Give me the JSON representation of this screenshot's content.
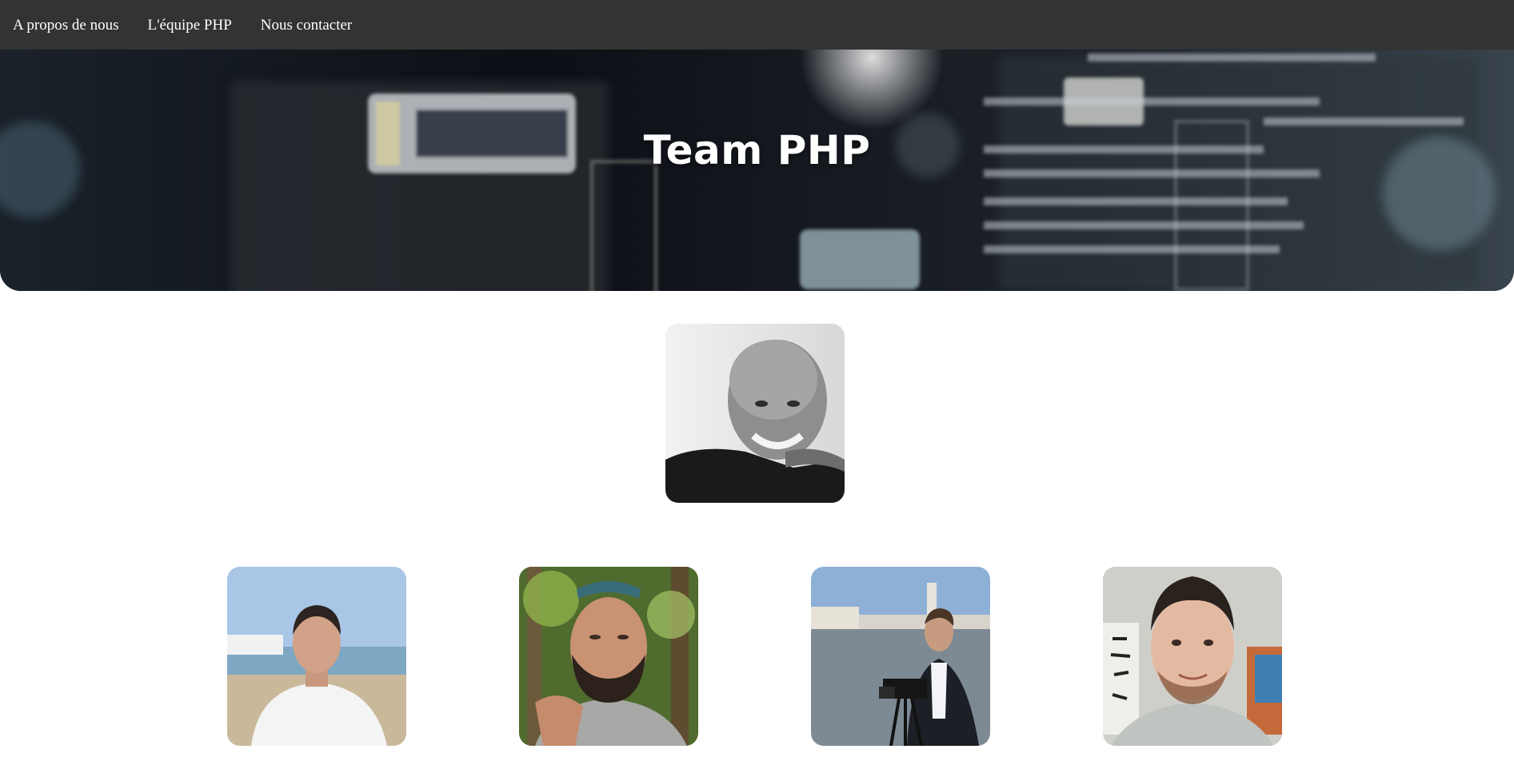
{
  "nav": {
    "items": [
      {
        "label": "A propos de nous"
      },
      {
        "label": "L'équipe PHP"
      },
      {
        "label": "Nous contacter"
      }
    ]
  },
  "hero": {
    "title": "Team PHP"
  },
  "team": {
    "lead": {
      "photo": "portrait-bald-man-bw"
    },
    "members": [
      {
        "photo": "portrait-young-man-beach"
      },
      {
        "photo": "portrait-bearded-man-forest"
      },
      {
        "photo": "portrait-man-camera-harbor"
      },
      {
        "photo": "portrait-man-indoor"
      }
    ]
  },
  "colors": {
    "navbar": "#333333",
    "nav_text": "#ffffff",
    "hero_text": "#ffffff",
    "page_bg": "#ffffff"
  }
}
